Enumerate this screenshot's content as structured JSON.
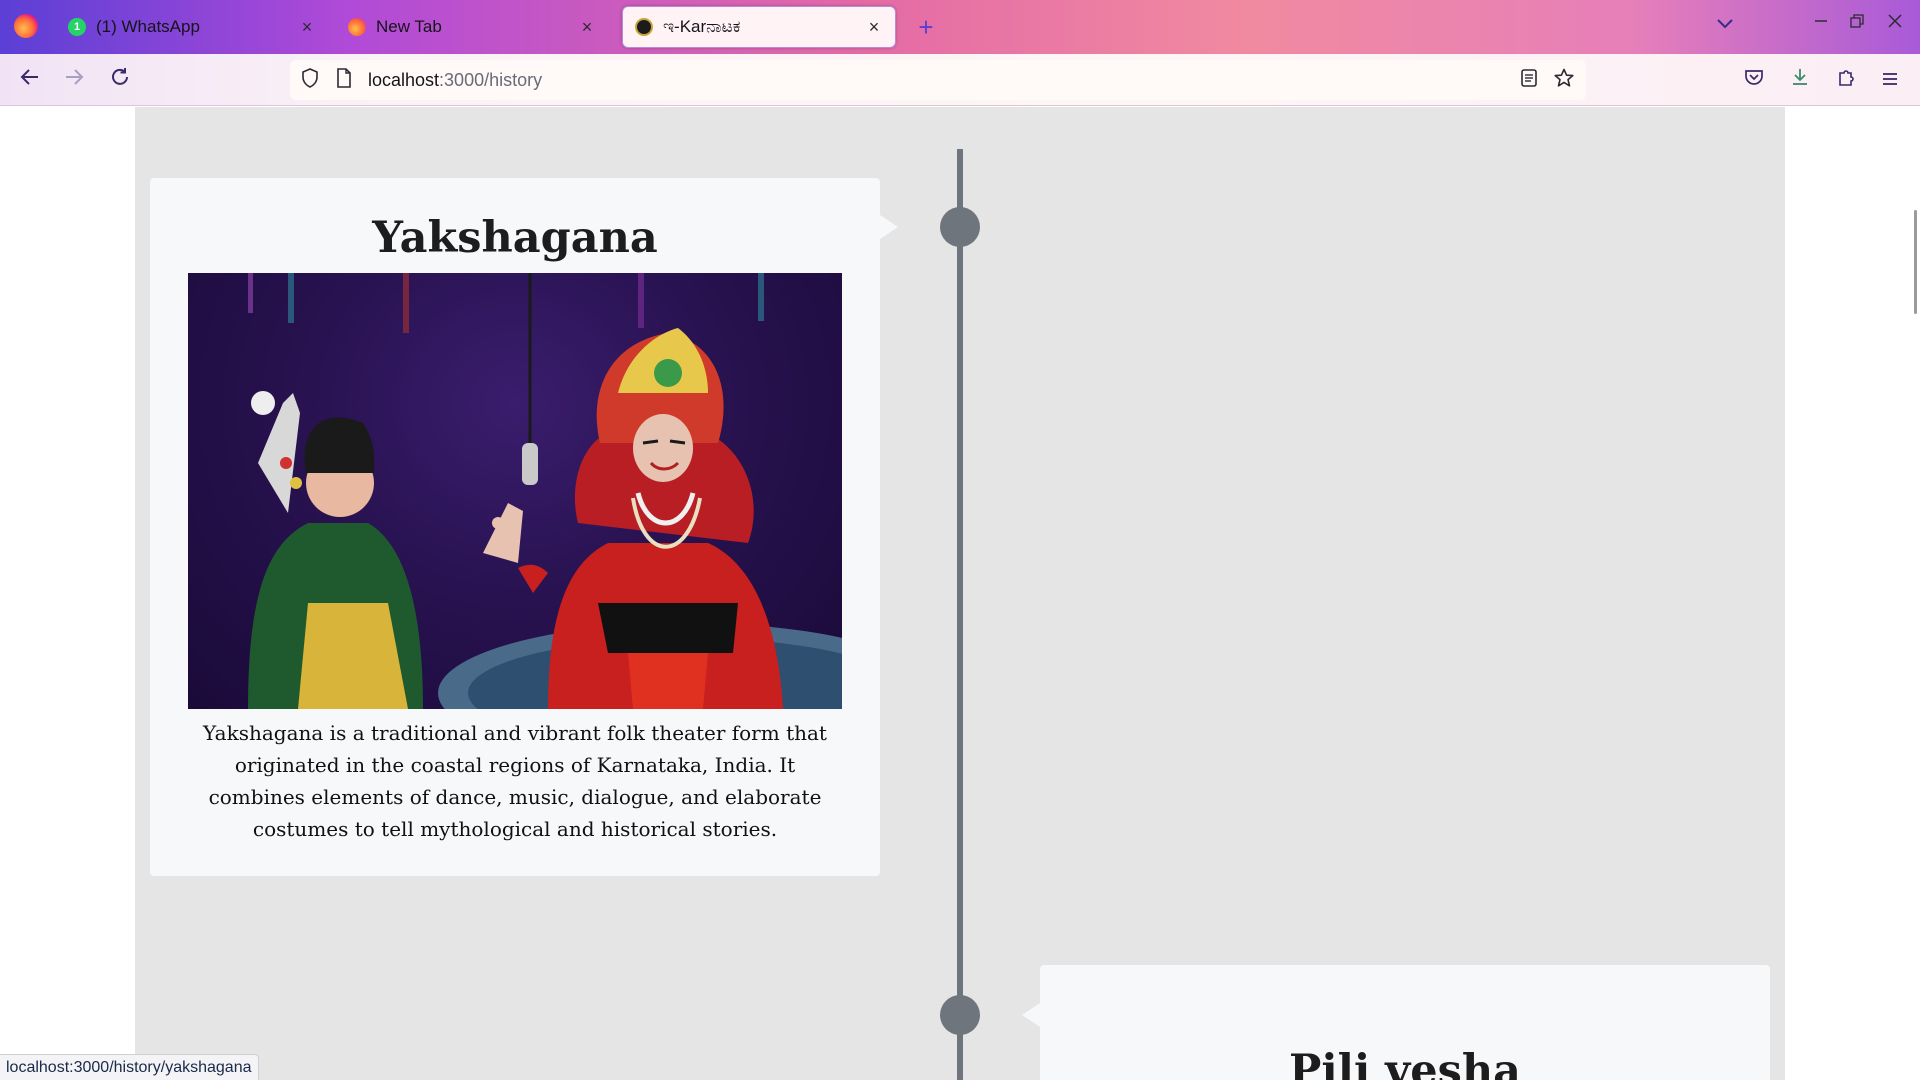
{
  "browser": {
    "tabs": [
      {
        "title": "(1) WhatsApp",
        "badge": "1",
        "favicon": "whatsapp-icon",
        "active": false
      },
      {
        "title": "New Tab",
        "favicon": "firefox-icon",
        "active": false
      },
      {
        "title": "ಇ-Karನಾಟಕ",
        "favicon": "site-logo-icon",
        "active": true
      }
    ],
    "close_glyph": "×",
    "new_tab_glyph": "+",
    "url_host": "localhost",
    "url_path": ":3000/history",
    "status_url": "localhost:3000/history/yakshagana",
    "colors": {
      "accent": "#5b3fd6",
      "timeline": "#6e757c",
      "card": "#f7f8fa",
      "content_bg": "#e5e5e5"
    }
  },
  "timeline": [
    {
      "title": "Yakshagana",
      "image_alt": "Yakshagana performers on stage",
      "description": "Yakshagana is a traditional and vibrant folk theater form that originated in the coastal regions of Karnataka, India. It combines elements of dance, music, dialogue, and elaborate costumes to tell mythological and historical stories."
    },
    {
      "title": "Pili vesha"
    }
  ]
}
